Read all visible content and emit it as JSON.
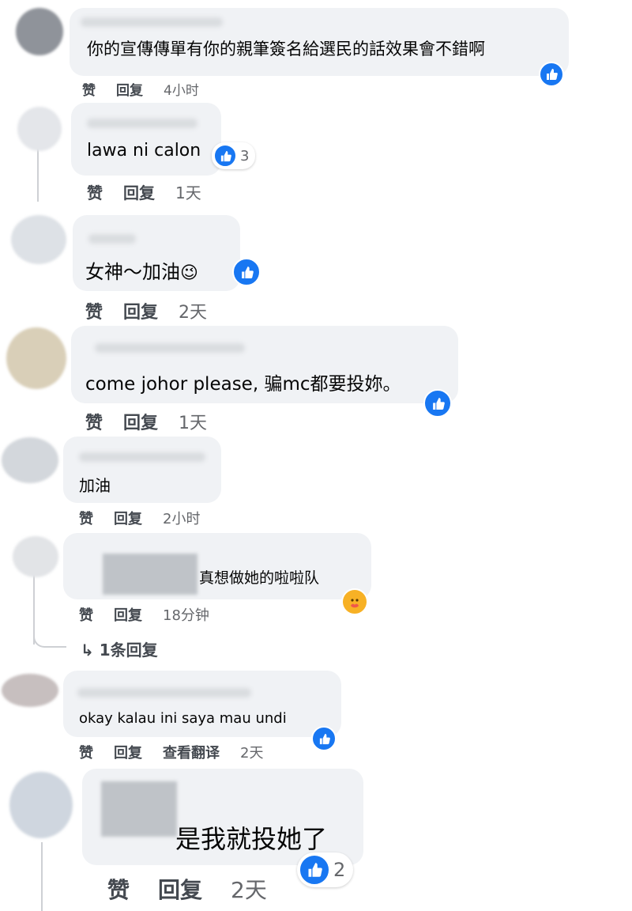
{
  "comments": [
    {
      "text": "你的宣傳傳單有你的親筆簽名給選民的話效果會不錯啊",
      "actions": [
        "赞",
        "回复"
      ],
      "time": "4小时",
      "reaction": "like",
      "count": ""
    },
    {
      "text": "lawa ni calon",
      "actions": [
        "赞",
        "回复"
      ],
      "time": "1天",
      "reaction": "like",
      "count": "3"
    },
    {
      "text": "女神～加油",
      "emoji": "😉",
      "actions": [
        "赞",
        "回复"
      ],
      "time": "2天",
      "reaction": "like",
      "count": ""
    },
    {
      "text": "come johor please, 骗mc都要投妳。",
      "actions": [
        "赞",
        "回复"
      ],
      "time": "1天",
      "reaction": "like",
      "count": ""
    },
    {
      "text": "加油",
      "actions": [
        "赞",
        "回复"
      ],
      "time": "2小时"
    },
    {
      "text": "真想做她的啦啦队",
      "actions": [
        "赞",
        "回复"
      ],
      "time": "18分钟",
      "reaction": "care",
      "reply_link": "↳ 1条回复"
    },
    {
      "text": "okay kalau ini saya mau undi",
      "actions": [
        "赞",
        "回复",
        "查看翻译"
      ],
      "time": "2天",
      "reaction": "like",
      "count": ""
    },
    {
      "text": "是我就投她了",
      "actions": [
        "赞",
        "回复"
      ],
      "time": "2天",
      "reaction": "like",
      "count": "2"
    }
  ],
  "colors": {
    "bubble": "#f0f2f5",
    "like_blue": "#1877f2",
    "meta_gray": "#65676b"
  }
}
